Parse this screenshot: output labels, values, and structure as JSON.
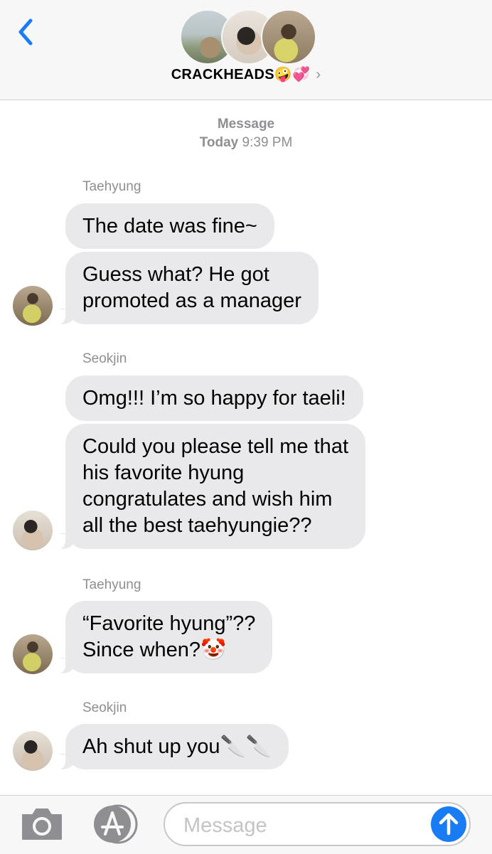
{
  "header": {
    "title": "CRACKHEADS",
    "title_emojis": "🤪💞",
    "chevron": "›",
    "icons": {
      "back": "chevron-left-icon",
      "details": "chevron-right-icon"
    }
  },
  "meta": {
    "service": "Message",
    "day": "Today",
    "time": "9:39 PM"
  },
  "conversation": [
    {
      "sender": "Taehyung",
      "messages": [
        {
          "lines": [
            "The date was fine~"
          ]
        },
        {
          "lines": [
            "Guess what? He got",
            "promoted as a manager"
          ]
        }
      ]
    },
    {
      "sender": "Seokjin",
      "messages": [
        {
          "lines": [
            "Omg!!! I’m so happy for taeli!"
          ]
        },
        {
          "lines": [
            "Could you please tell me that",
            "his favorite hyung",
            "congratulates and wish him",
            "all the best taehyungie??"
          ]
        }
      ]
    },
    {
      "sender": "Taehyung",
      "messages": [
        {
          "lines": [
            "“Favorite hyung”??",
            "Since when?🤡"
          ]
        }
      ]
    },
    {
      "sender": "Seokjin",
      "messages": [
        {
          "lines": [
            "Ah shut up you🔪🔪"
          ]
        }
      ]
    }
  ],
  "input": {
    "placeholder": "Message",
    "icons": {
      "camera": "camera-icon",
      "apps": "app-store-icon",
      "send": "send-arrow-icon"
    }
  },
  "colors": {
    "accent": "#1a7cf5",
    "bubble": "#e9e9eb",
    "secondary_text": "#8e8e93"
  }
}
